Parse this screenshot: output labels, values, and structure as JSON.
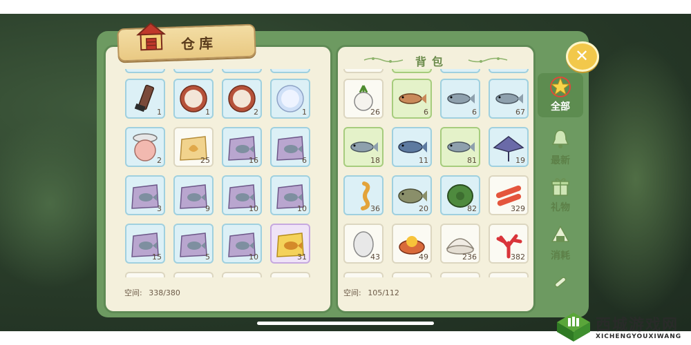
{
  "warehouse": {
    "title": "仓库",
    "capacity_label": "空间:",
    "capacity_value": "338/380",
    "items": [
      {
        "icon": "tube-icon",
        "count": "1",
        "style": "blue"
      },
      {
        "icon": "copper-plate-icon",
        "count": "1",
        "style": "blue"
      },
      {
        "icon": "copper-plate-icon",
        "count": "2",
        "style": "blue"
      },
      {
        "icon": "pearl-plate-icon",
        "count": "1",
        "style": "blue"
      },
      {
        "icon": "compact-mirror-icon",
        "count": "2",
        "style": "blue"
      },
      {
        "icon": "yellow-seed-bag-icon",
        "count": "25",
        "style": "white"
      },
      {
        "icon": "fish-bag-icon",
        "count": "16",
        "style": "blue"
      },
      {
        "icon": "fish-bag-icon",
        "count": "6",
        "style": "blue"
      },
      {
        "icon": "fish-bag-icon",
        "count": "3",
        "style": "blue"
      },
      {
        "icon": "fish-bag-icon",
        "count": "9",
        "style": "blue"
      },
      {
        "icon": "fish-bag-icon",
        "count": "10",
        "style": "blue"
      },
      {
        "icon": "fish-bag-icon",
        "count": "10",
        "style": "blue"
      },
      {
        "icon": "fish-bag-icon",
        "count": "15",
        "style": "blue"
      },
      {
        "icon": "fish-bag-icon",
        "count": "5",
        "style": "blue"
      },
      {
        "icon": "fish-bag-icon",
        "count": "10",
        "style": "blue"
      },
      {
        "icon": "gold-fish-bag-icon",
        "count": "31",
        "style": "purple"
      }
    ]
  },
  "backpack": {
    "title": "背包",
    "capacity_label": "空间:",
    "capacity_value": "105/112",
    "items": [
      {
        "icon": "turnip-icon",
        "count": "26",
        "style": "white"
      },
      {
        "icon": "trout-icon",
        "count": "6",
        "style": "green"
      },
      {
        "icon": "fish-icon",
        "count": "6",
        "style": "blue"
      },
      {
        "icon": "fish-icon",
        "count": "67",
        "style": "blue"
      },
      {
        "icon": "fish-icon",
        "count": "18",
        "style": "green"
      },
      {
        "icon": "tuna-icon",
        "count": "11",
        "style": "blue"
      },
      {
        "icon": "fish-icon",
        "count": "81",
        "style": "green"
      },
      {
        "icon": "manta-ray-icon",
        "count": "19",
        "style": "blue"
      },
      {
        "icon": "seahorse-icon",
        "count": "36",
        "style": "blue"
      },
      {
        "icon": "grouper-icon",
        "count": "20",
        "style": "blue"
      },
      {
        "icon": "turtle-shell-icon",
        "count": "82",
        "style": "blue"
      },
      {
        "icon": "crab-stick-icon",
        "count": "329",
        "style": "white"
      },
      {
        "icon": "egg-stone-icon",
        "count": "43",
        "style": "white"
      },
      {
        "icon": "sea-urchin-egg-icon",
        "count": "49",
        "style": "white"
      },
      {
        "icon": "clam-icon",
        "count": "236",
        "style": "white"
      },
      {
        "icon": "red-coral-icon",
        "count": "382",
        "style": "white"
      }
    ]
  },
  "sidebar": {
    "tabs": [
      {
        "label": "全部",
        "icon": "star-icon",
        "active": true
      },
      {
        "label": "最新",
        "icon": "bell-icon",
        "active": false
      },
      {
        "label": "礼物",
        "icon": "gift-icon",
        "active": false
      },
      {
        "label": "消耗",
        "icon": "rice-ball-icon",
        "active": false
      },
      {
        "label": "",
        "icon": "scroll-icon",
        "active": false
      }
    ]
  },
  "close_button": {
    "label": "✕"
  },
  "watermark": {
    "cn": "西城游戏网",
    "en": "XICHENGYOUXIWANG"
  }
}
